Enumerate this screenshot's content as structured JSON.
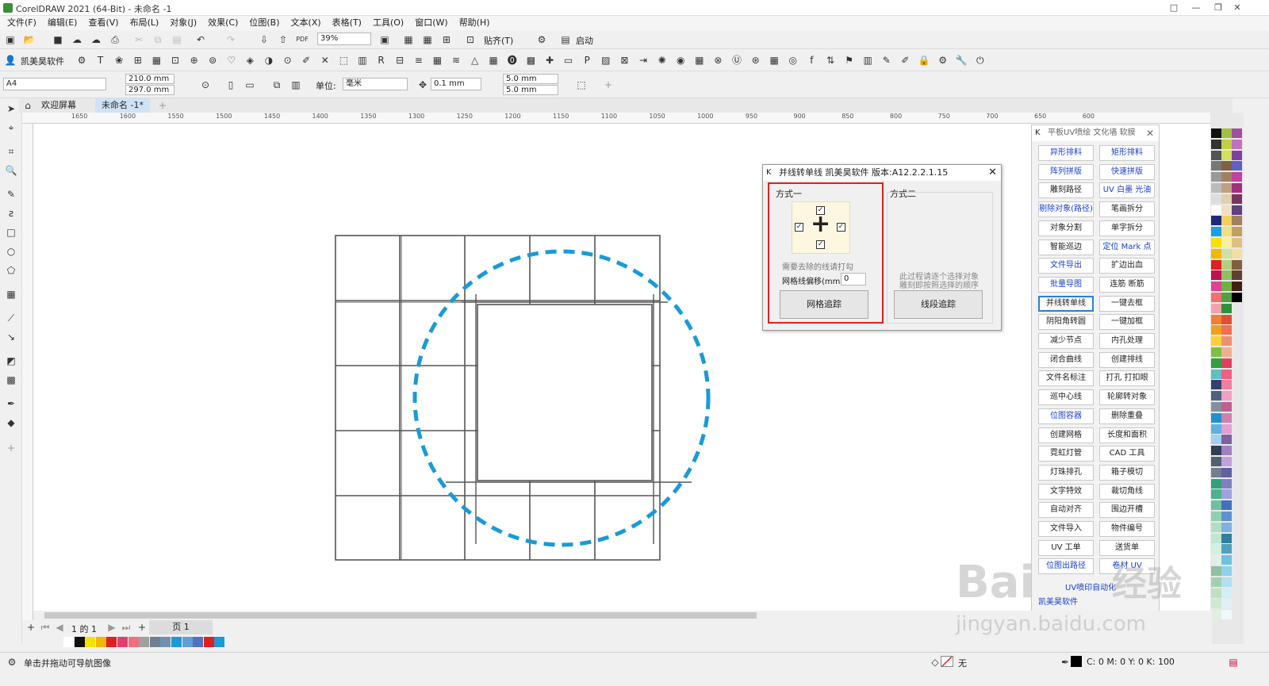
{
  "window": {
    "title": "CorelDRAW 2021 (64-Bit) - 未命名 -1"
  },
  "menu": [
    "文件(F)",
    "编辑(E)",
    "查看(V)",
    "布局(L)",
    "对象(J)",
    "效果(C)",
    "位图(B)",
    "文本(X)",
    "表格(T)",
    "工具(O)",
    "窗口(W)",
    "帮助(H)"
  ],
  "toolbar": {
    "zoom": "39%",
    "paste_label": "贴齐(T)",
    "launch_label": "启动"
  },
  "plugin_bar": {
    "brand": "凯美昊软件"
  },
  "property_bar": {
    "page_size": "A4",
    "width": "210.0 mm",
    "height": "297.0 mm",
    "unit_label": "单位:",
    "unit_value": "毫米",
    "nudge": "0.1 mm",
    "dup_x": "5.0 mm",
    "dup_y": "5.0 mm"
  },
  "tabs": {
    "welcome": "欢迎屏幕",
    "doc": "未命名 -1*"
  },
  "ruler": {
    "ticks": [
      "1650",
      "1600",
      "1550",
      "1500",
      "1450",
      "1400",
      "1350",
      "1300",
      "1250",
      "1200",
      "1150",
      "1100",
      "1050",
      "1000",
      "950",
      "900",
      "850",
      "800",
      "750",
      "700",
      "650",
      "600"
    ]
  },
  "dialog": {
    "title": "并线转单线 凯美昊软件 版本:A12.2.2.1.15",
    "method1": "方式一",
    "method2": "方式二",
    "hint1": "需要去除的线请打勾",
    "offset_label": "网格线偏移(mm)",
    "offset_value": "0",
    "btn_grid": "网格追踪",
    "hint2_line1": "此过程请逐个选择对象",
    "hint2_line2": "雕刻即按照选择的顺序",
    "btn_segment": "线段追踪"
  },
  "panel": {
    "title": "平板UV喷绘 文化墙 软膜",
    "buttons": [
      {
        "label": "异形排料",
        "blue": true
      },
      {
        "label": "矩形排料",
        "blue": true
      },
      {
        "label": "阵列拼版",
        "blue": true
      },
      {
        "label": "快速拼版",
        "blue": true
      },
      {
        "label": "雕刻路径",
        "blue": false
      },
      {
        "label": "UV 白墨 光油",
        "blue": true
      },
      {
        "label": "剔除对象(路径)",
        "blue": true
      },
      {
        "label": "笔画拆分",
        "blue": false
      },
      {
        "label": "对象分割",
        "blue": false
      },
      {
        "label": "单字拆分",
        "blue": false
      },
      {
        "label": "智能巡边",
        "blue": false
      },
      {
        "label": "定位 Mark 点",
        "blue": true
      },
      {
        "label": "文件导出",
        "blue": true
      },
      {
        "label": "扩边出血",
        "blue": false
      },
      {
        "label": "批量导图",
        "blue": true
      },
      {
        "label": "连筋 断筋",
        "blue": false
      },
      {
        "label": "并线转单线",
        "blue": false,
        "selected": true
      },
      {
        "label": "一键去框",
        "blue": false
      },
      {
        "label": "阴阳角转圆",
        "blue": false
      },
      {
        "label": "一键加框",
        "blue": false
      },
      {
        "label": "减少节点",
        "blue": false
      },
      {
        "label": "内孔处理",
        "blue": false
      },
      {
        "label": "闭合曲线",
        "blue": false
      },
      {
        "label": "创建排线",
        "blue": false
      },
      {
        "label": "文件名标注",
        "blue": false
      },
      {
        "label": "打孔 打扣眼",
        "blue": false
      },
      {
        "label": "巡中心线",
        "blue": false
      },
      {
        "label": "轮廓转对象",
        "blue": false
      },
      {
        "label": "位图容器",
        "blue": true
      },
      {
        "label": "删除重叠",
        "blue": false
      },
      {
        "label": "创建网格",
        "blue": false
      },
      {
        "label": "长度和面积",
        "blue": false
      },
      {
        "label": "霓虹灯管",
        "blue": false
      },
      {
        "label": "CAD 工具",
        "blue": false
      },
      {
        "label": "灯珠排孔",
        "blue": false
      },
      {
        "label": "箱子模切",
        "blue": false
      },
      {
        "label": "文字特效",
        "blue": false
      },
      {
        "label": "裁切角线",
        "blue": false
      },
      {
        "label": "自动对齐",
        "blue": false
      },
      {
        "label": "围边开槽",
        "blue": false
      },
      {
        "label": "文件导入",
        "blue": false
      },
      {
        "label": "物件编号",
        "blue": false
      },
      {
        "label": "UV 工单",
        "blue": false
      },
      {
        "label": "送货单",
        "blue": false
      },
      {
        "label": "位图出路径",
        "blue": true
      },
      {
        "label": "卷材 UV",
        "blue": true
      }
    ],
    "footer1": "UV喷印自动化",
    "footer2": "凯美昊软件"
  },
  "pagebar": {
    "page_of": "1 的 1",
    "page_tab": "页 1"
  },
  "status": {
    "hint": "单击并拖动可导航图像",
    "fill_none": "无",
    "cmyk": "C: 0 M: 0 Y: 0 K: 100"
  },
  "watermark": {
    "logo": "Bai",
    "logo_cn": "经验",
    "url": "jingyan.baidu.com"
  },
  "colors": {
    "accent_blue": "#1a9ad7",
    "highlight_red": "#e02020"
  }
}
